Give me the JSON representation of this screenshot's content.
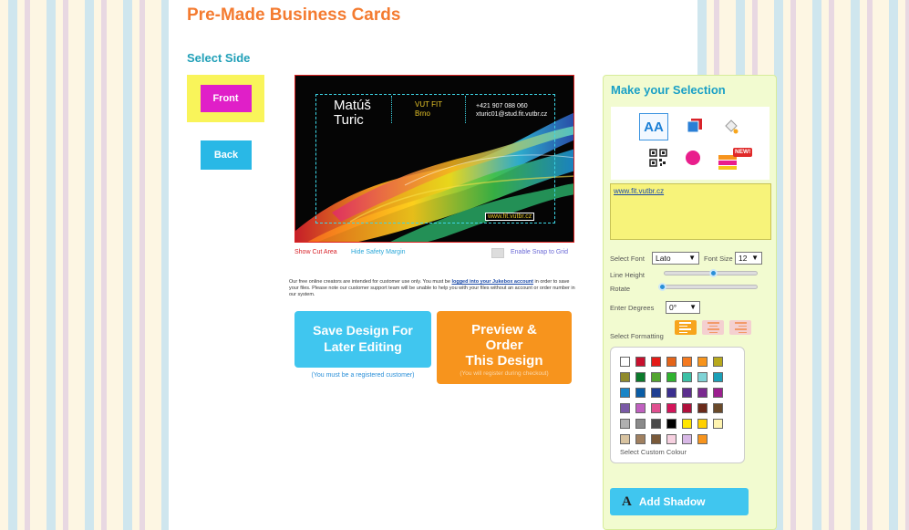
{
  "colors": {
    "title": "#f47b30",
    "accent": "#21a0b8",
    "front_button": "#e01fc8",
    "front_highlight": "#f9f45a",
    "blue_button": "#29b8e6",
    "orange_button": "#f7941d",
    "panel_bg": "#f2fbd0"
  },
  "page": {
    "title": "Pre-Made Business Cards",
    "select_side": "Select Side"
  },
  "sides": {
    "front_label": "Front",
    "back_label": "Back"
  },
  "card": {
    "name_line1": "Matúš",
    "name_line2": "Turic",
    "org_line1": "VUT FIT",
    "org_line2": "Brno",
    "phone": "+421 907 088 060",
    "email": "xturic01@stud.fit.vutbr.cz",
    "website": "www.fit.vutbr.cz"
  },
  "card_controls": {
    "show_cut_area": "Show Cut Area",
    "hide_safety_margin": "Hide Safety Margin",
    "enable_snap": "Enable Snap to Grid"
  },
  "notice": {
    "before_link": "Our free online creators are intended for customer use only. You must be ",
    "link_text": "logged into your Jukebox account",
    "after_link": " in order to save your files. Please note our customer support team will be unable to help you with your files without an account or order number in our system."
  },
  "actions": {
    "save_line1": "Save Design For",
    "save_line2": "Later Editing",
    "save_note": "(You must be a registered customer)",
    "preview_line1": "Preview &",
    "preview_line2": "Order",
    "preview_line3": "This Design",
    "preview_note": "(You will register during checkout)"
  },
  "panel": {
    "title": "Make your Selection",
    "tools": [
      {
        "name": "text-tool",
        "label": "AA"
      },
      {
        "name": "image-tool"
      },
      {
        "name": "fill-tool"
      },
      {
        "name": "qr-code-tool"
      },
      {
        "name": "shape-tool"
      },
      {
        "name": "background-tool",
        "badge": "NEW!"
      }
    ],
    "text_value": "www.fit.vutbr.cz",
    "select_font_label": "Select Font",
    "font_value": "Lato",
    "font_size_label": "Font Size",
    "font_size_value": "12",
    "line_height_label": "Line Height",
    "rotate_label": "Rotate",
    "enter_degrees_label": "Enter Degrees",
    "degrees_value": "0°",
    "select_formatting_label": "Select Formatting",
    "formatting": [
      "align-left",
      "align-center",
      "align-right"
    ],
    "custom_colour_label": "Select Custom Colour",
    "add_shadow_label": "Add Shadow",
    "swatches": [
      [
        "#ffffff",
        "#c8102e",
        "#e41b17",
        "#e46419",
        "#f47920",
        "#f7941d",
        "#b8a91c"
      ],
      [
        "#8f8a2b",
        "#0b7a2b",
        "#53a52f",
        "#2fb32f",
        "#3cc0a5",
        "#7fd3d6",
        "#1aa0b8"
      ],
      [
        "#1a85c6",
        "#0a5da6",
        "#1f3f92",
        "#3b2f8f",
        "#5c2f8f",
        "#7a2a8f",
        "#9c1f8f"
      ],
      [
        "#7a5aa6",
        "#c060c0",
        "#e05090",
        "#d4145a",
        "#b0103c",
        "#6a2a1a",
        "#6a4a2a"
      ],
      [
        "#b0b0b0",
        "#8a8a8a",
        "#4a4a4a",
        "#000000",
        "#ffe600",
        "#ffd000",
        "#fff4b0"
      ],
      [
        "#d8c3a0",
        "#a08060",
        "#7a5a3a",
        "#f6d0e0",
        "#d8b8e6",
        "#f7941d"
      ]
    ]
  }
}
